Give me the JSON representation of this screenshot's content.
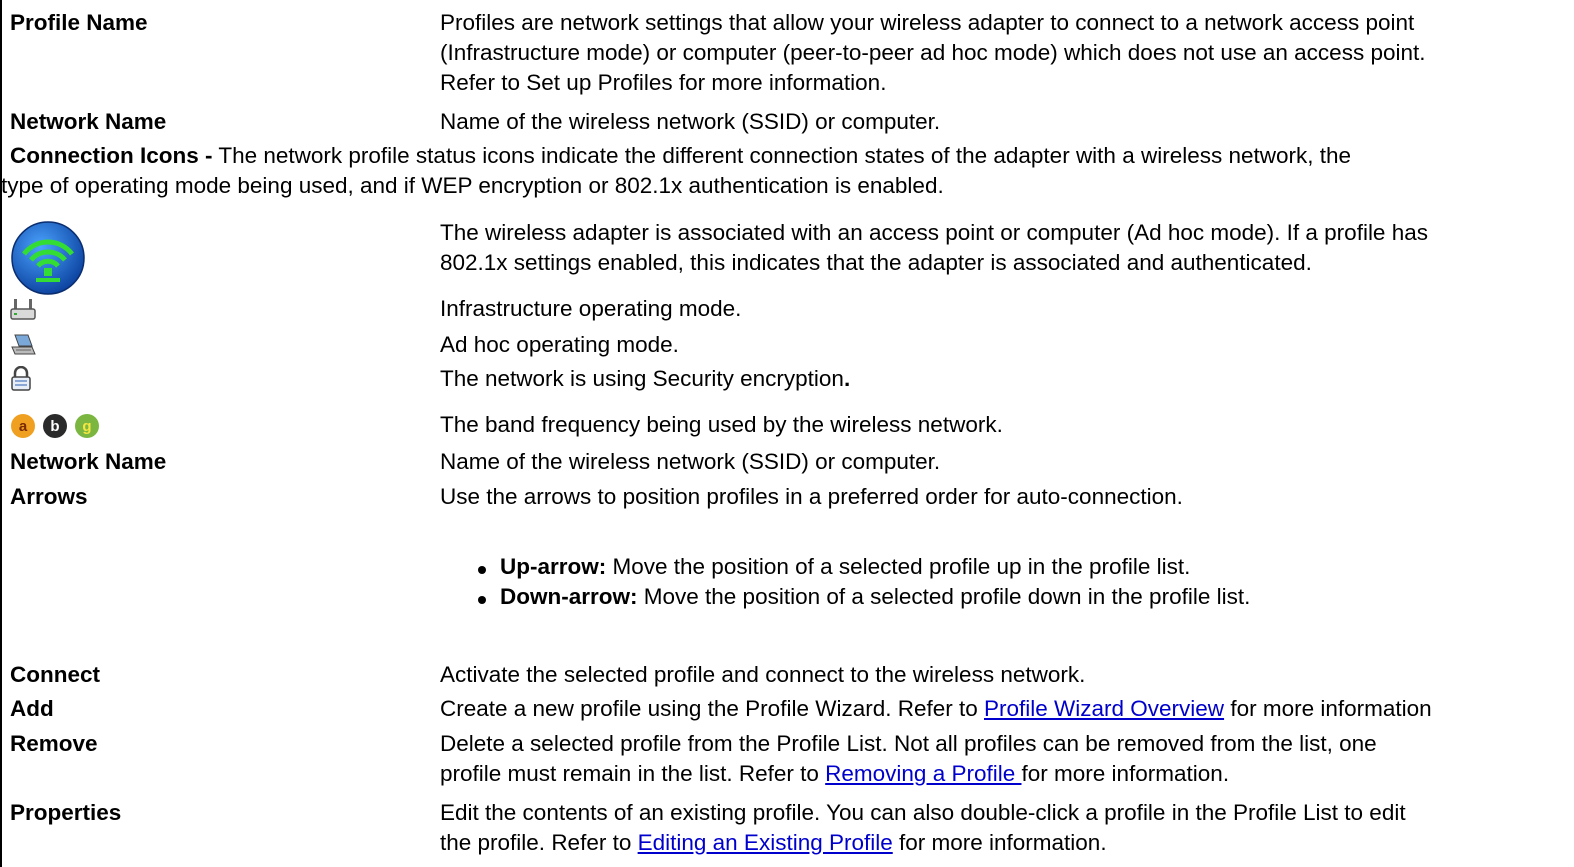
{
  "rows": {
    "profile_name": {
      "term": "Profile Name",
      "desc": [
        "Profiles are network settings that allow your wireless adapter to connect to a network access point",
        "(Infrastructure mode) or computer (peer-to-peer ad hoc mode) which does not use an access point.",
        "Refer to Set up Profiles for more information."
      ]
    },
    "network_name_1": {
      "term": "Network Name",
      "desc": "Name of the wireless network (SSID) or computer."
    },
    "connection_icons": {
      "lead": "Connection Icons -",
      "text_1": " The network profile status icons indicate the different connection states of the adapter with a wireless network, the",
      "text_2": "type of operating mode being used, and if WEP encryption or 802.1x authentication is enabled."
    },
    "associated": {
      "desc": [
        "The wireless adapter is associated with an access point or computer (Ad hoc mode). If a profile has",
        "802.1x settings enabled, this indicates that the adapter is associated and authenticated."
      ]
    },
    "infrastructure": {
      "desc": "Infrastructure operating mode."
    },
    "adhoc": {
      "desc": "Ad hoc operating mode."
    },
    "security": {
      "desc": "The network is using Security encryption",
      "desc_end": "."
    },
    "band": {
      "desc": "The band frequency being used by the wireless network.",
      "icons": [
        "a",
        "b",
        "g"
      ]
    },
    "network_name_2": {
      "term": "Network Name",
      "desc": "Name of the wireless network (SSID) or computer."
    },
    "arrows": {
      "term": "Arrows",
      "desc": "Use the arrows to position profiles in a preferred order for auto-connection.",
      "bullets": [
        {
          "label": "Up-arrow:",
          "text": " Move the position of a selected profile up in the profile list."
        },
        {
          "label": "Down-arrow:",
          "text": " Move the position of a selected profile down in the profile list."
        }
      ]
    },
    "connect": {
      "term": "Connect",
      "desc": "Activate the selected profile and connect to the wireless network."
    },
    "add": {
      "term": "Add",
      "pre": "Create a new profile using the Profile Wizard. Refer to ",
      "link": "Profile Wizard Overview",
      "post": " for more information"
    },
    "remove": {
      "term": "Remove",
      "line_1": "Delete a selected profile from the Profile List. Not all profiles can be removed from the list, one",
      "pre": "profile must remain in the list. Refer to ",
      "link": "Removing a Profile ",
      "post": "for more information."
    },
    "properties": {
      "term": "Properties",
      "line_1": "Edit the contents of an existing profile. You can also double-click a profile in the Profile List to edit",
      "pre": "the profile. Refer to ",
      "link": "Editing an Existing Profile",
      "post": " for more information."
    }
  },
  "colors": {
    "link": "#0000cc",
    "wifi_circle": "#1f6fd1",
    "band_a": "#f0a020",
    "band_b": "#2a2a2a",
    "band_g": "#7ab640"
  },
  "icon_names": [
    "wifi-associated-icon",
    "infrastructure-router-icon",
    "adhoc-computer-icon",
    "lock-icon",
    "band-a-icon",
    "band-b-icon",
    "band-g-icon"
  ]
}
